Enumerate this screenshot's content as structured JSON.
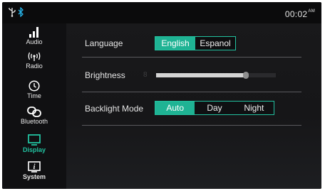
{
  "status": {
    "time": "00:02",
    "ampm": "AM",
    "icons": [
      "usb-icon",
      "bluetooth-icon"
    ]
  },
  "sidebar": {
    "items": [
      {
        "label": "Audio",
        "icon": "audio-bars-icon"
      },
      {
        "label": "Radio",
        "icon": "radio-wave-icon"
      },
      {
        "label": "Time",
        "icon": "clock-icon"
      },
      {
        "label": "Bluetooth",
        "icon": "bluetooth-link-icon"
      },
      {
        "label": "Display",
        "icon": "monitor-icon",
        "active": true
      },
      {
        "label": "System",
        "icon": "info-icon"
      }
    ]
  },
  "settings": {
    "language": {
      "label": "Language",
      "options": [
        "English",
        "Espanol"
      ],
      "selected": "English"
    },
    "brightness": {
      "label": "Brightness",
      "value": "8",
      "level_fraction": 0.75
    },
    "backlight": {
      "label": "Backlight Mode",
      "options": [
        "Auto",
        "Day",
        "Night"
      ],
      "selected": "Auto"
    }
  },
  "colors": {
    "accent": "#1fb394",
    "background": "#141416",
    "text": "#e4e4e4"
  }
}
